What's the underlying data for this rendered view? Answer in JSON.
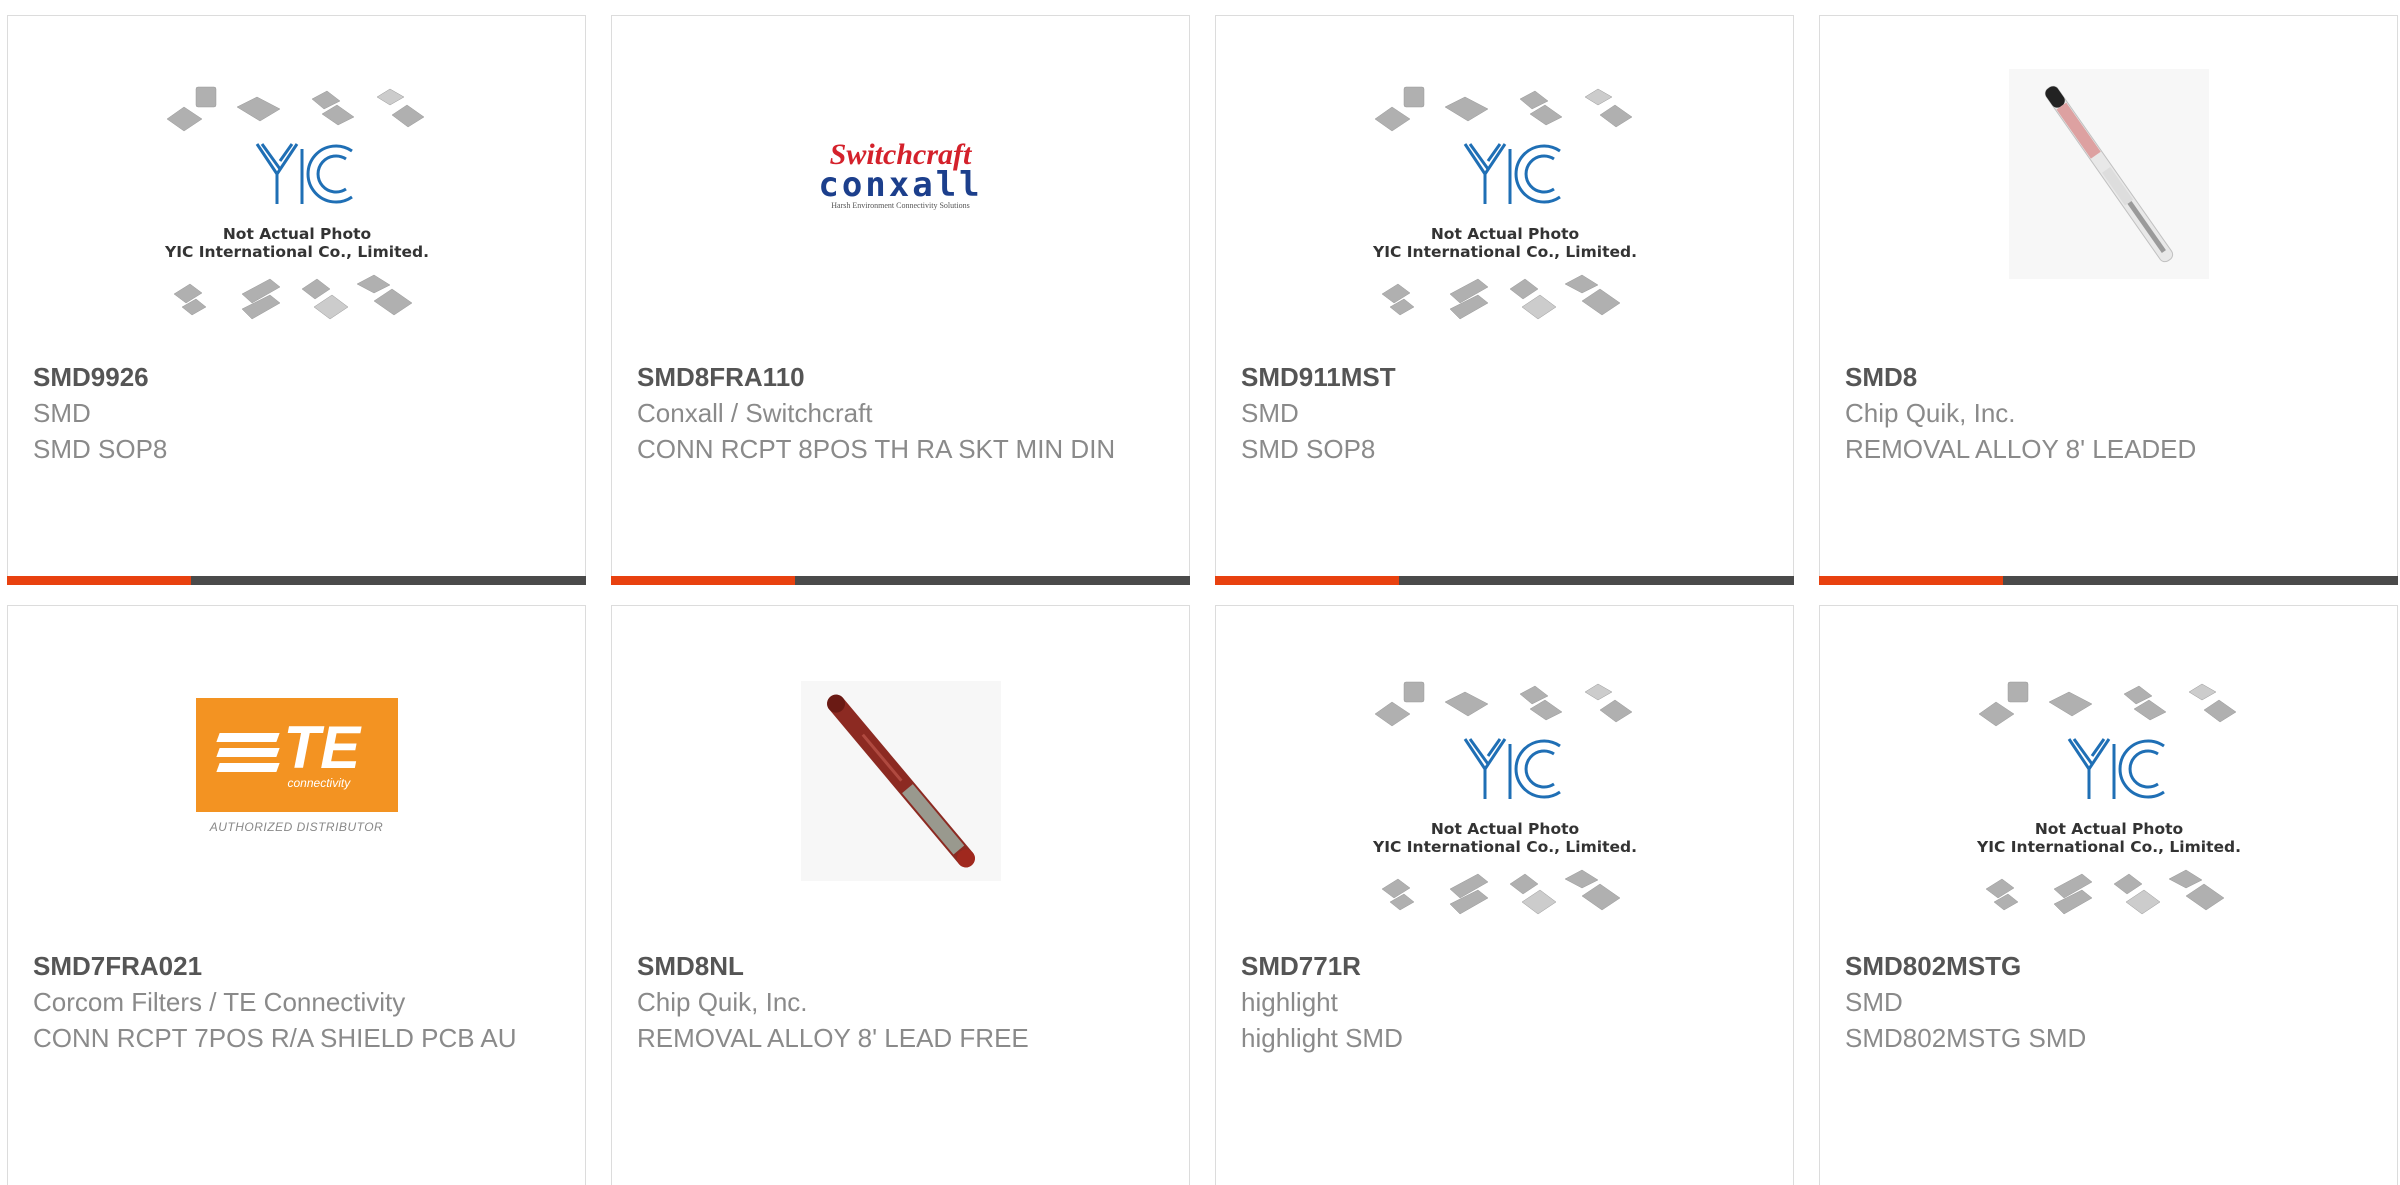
{
  "products": [
    {
      "part": "SMD9926",
      "brand": "SMD",
      "desc": "SMD SOP8",
      "image": "yic-placeholder"
    },
    {
      "part": "SMD8FRA110",
      "brand": "Conxall / Switchcraft",
      "desc": "CONN RCPT 8POS TH RA SKT MIN DIN",
      "image": "switchcraft-conxall-logo"
    },
    {
      "part": "SMD911MST",
      "brand": "SMD",
      "desc": "SMD SOP8",
      "image": "yic-placeholder"
    },
    {
      "part": "SMD8",
      "brand": "Chip Quik, Inc.",
      "desc": "REMOVAL ALLOY 8' LEADED",
      "image": "alloy-tube-photo"
    },
    {
      "part": "SMD7FRA021",
      "brand": "Corcom Filters / TE Connectivity",
      "desc": "CONN RCPT 7POS R/A SHIELD PCB AU",
      "image": "te-connectivity-logo"
    },
    {
      "part": "SMD8NL",
      "brand": "Chip Quik, Inc.",
      "desc": "REMOVAL ALLOY 8' LEAD FREE",
      "image": "alloy-tube-photo"
    },
    {
      "part": "SMD771R",
      "brand": "highlight",
      "desc": "highlight SMD",
      "image": "yic-placeholder"
    },
    {
      "part": "SMD802MSTG",
      "brand": "SMD",
      "desc": "SMD802MSTG SMD",
      "image": "yic-placeholder"
    }
  ],
  "placeholder": {
    "line1": "Not Actual Photo",
    "line2": "YIC International Co., Limited.",
    "logo": "YIC"
  },
  "logos": {
    "switchcraft": {
      "top": "Switchcraft",
      "mid": "conxall",
      "sub": "Harsh Environment Connectivity Solutions"
    },
    "te": {
      "main": "TE",
      "sub": "connectivity",
      "auth": "AUTHORIZED DISTRIBUTOR"
    }
  },
  "colors": {
    "accent": "#e8410f",
    "bar": "#4a4a4a",
    "part": "#555555",
    "text": "#8a8a8a",
    "border": "#dcdcdc",
    "te_orange": "#f39322",
    "switchcraft_red": "#d4212b",
    "conxall_blue": "#1c3f8c"
  }
}
